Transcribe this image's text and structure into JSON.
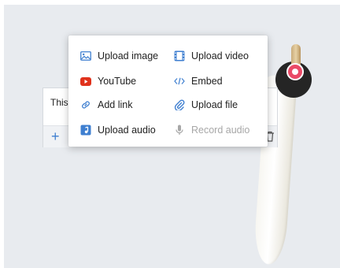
{
  "card": {
    "text": "This",
    "add_label": "+"
  },
  "menu": {
    "items": [
      {
        "label": "Upload image",
        "icon": "image-icon",
        "enabled": true
      },
      {
        "label": "Upload video",
        "icon": "film-icon",
        "enabled": true
      },
      {
        "label": "YouTube",
        "icon": "youtube-icon",
        "enabled": true
      },
      {
        "label": "Embed",
        "icon": "code-icon",
        "enabled": true
      },
      {
        "label": "Add link",
        "icon": "link-icon",
        "enabled": true
      },
      {
        "label": "Upload file",
        "icon": "paperclip-icon",
        "enabled": true
      },
      {
        "label": "Upload audio",
        "icon": "music-file-icon",
        "enabled": true
      },
      {
        "label": "Record audio",
        "icon": "microphone-icon",
        "enabled": false
      }
    ]
  },
  "colors": {
    "accent": "#3f7fd0",
    "youtube": "#e0321c",
    "record": "#ea4a67",
    "disabled": "#a7a7a7"
  }
}
